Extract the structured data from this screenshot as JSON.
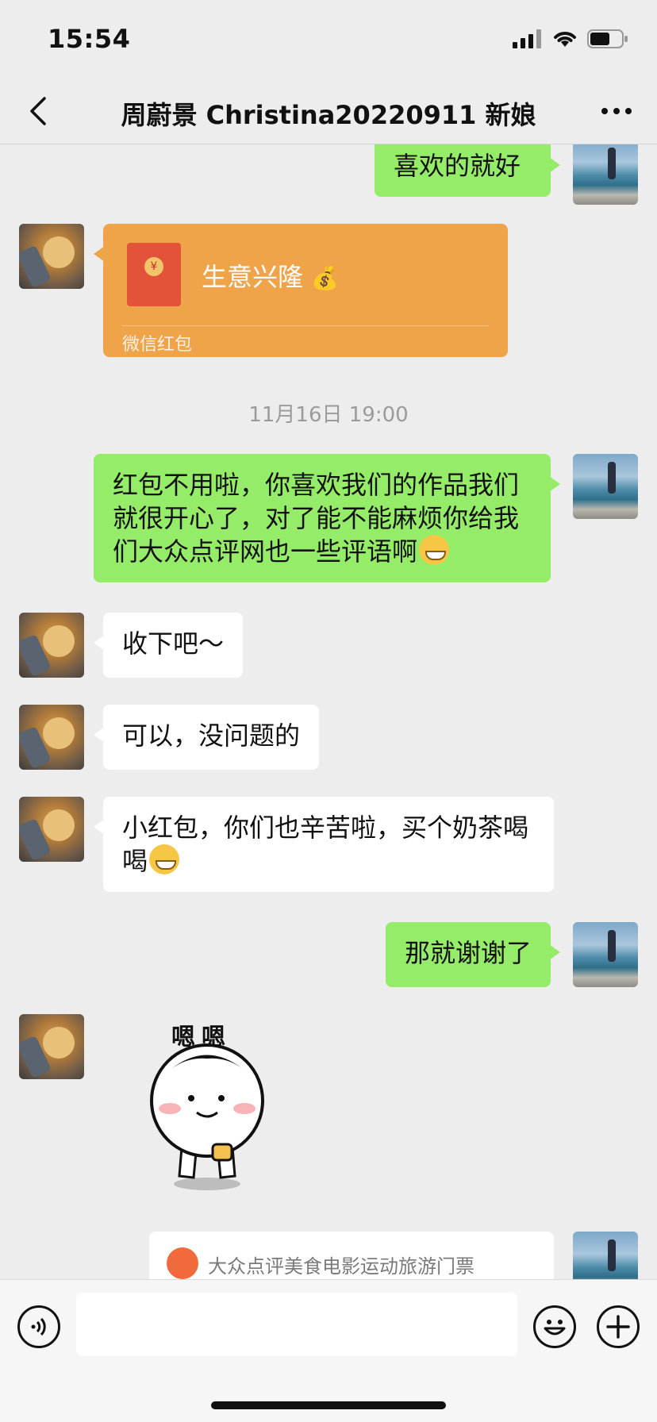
{
  "status": {
    "time": "15:54"
  },
  "nav": {
    "title": "周蔚景 Christina20220911 新娘"
  },
  "messages": {
    "m1": "喜欢的就好",
    "redpacket_title": "生意兴隆",
    "redpacket_caption": "微信红包",
    "timestamp": "11月16日 19:00",
    "m2": "红包不用啦，你喜欢我们的作品我们就很开心了，对了能不能麻烦你给我们大众点评网也一些评语啊",
    "m3": "收下吧～",
    "m4": "可以，没问题的",
    "m5": "小红包，你们也辛苦啦，买个奶茶喝喝",
    "m6": "那就谢谢了",
    "sticker_text": "嗯嗯",
    "card_text": "大众点评美食电影运动旅游门票"
  },
  "input": {
    "placeholder": ""
  },
  "colors": {
    "bubble_me": "#95ec69",
    "bubble_other": "#ffffff",
    "redpacket": "#f0a44a",
    "background": "#ededed"
  }
}
